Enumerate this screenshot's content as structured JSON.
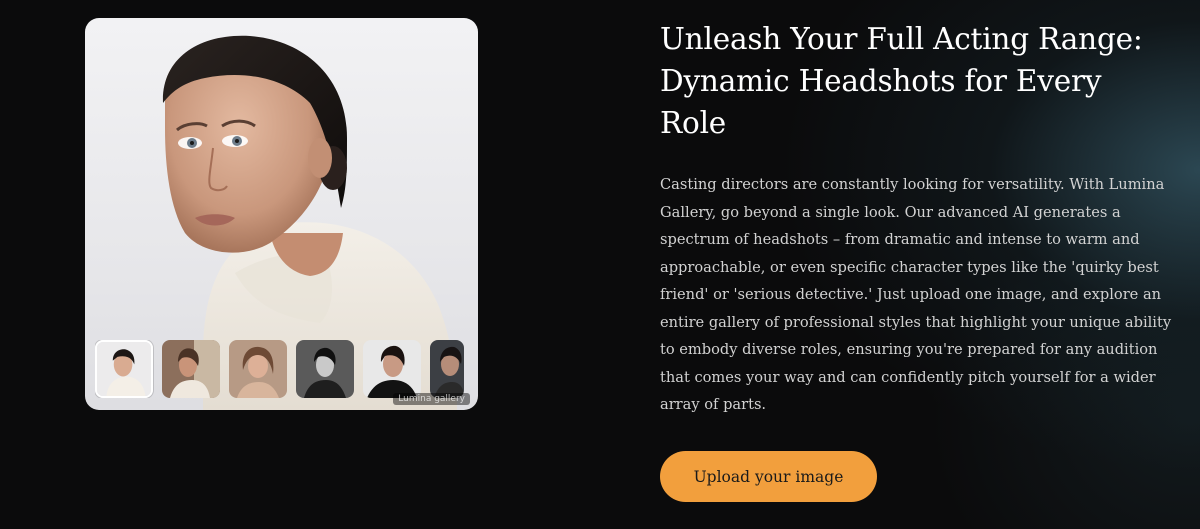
{
  "hero": {
    "title": "Unleash Your Full Acting Range: Dynamic Headshots for Every Role",
    "description": "Casting directors are constantly looking for versatility. With Lumina Gallery, go beyond a single look. Our advanced AI generates a spectrum of headshots – from dramatic and intense to warm and approachable, or even specific character types like the 'quirky best friend' or 'serious detective.' Just upload one image, and explore an entire gallery of professional styles that highlight your unique ability to embody diverse roles, ensuring you're prepared for any audition that comes your way and can confidently pitch yourself for a wider array of parts.",
    "cta_label": "Upload your image"
  },
  "gallery": {
    "watermark": "Lumina gallery",
    "thumbnails": [
      {
        "name": "white-turtleneck",
        "selected": true
      },
      {
        "name": "warm-tone"
      },
      {
        "name": "soft-glam"
      },
      {
        "name": "black-white"
      },
      {
        "name": "dark-dramatic"
      },
      {
        "name": "moody-partial"
      }
    ]
  },
  "colors": {
    "background": "#0b0b0c",
    "accent_button": "#f29f3d",
    "glow": "#46788c"
  }
}
